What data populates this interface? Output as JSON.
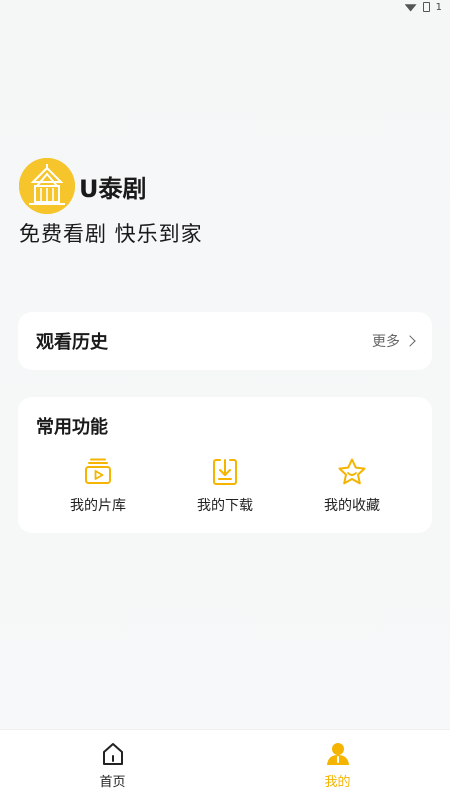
{
  "status_bar": {
    "time_fragment": "1"
  },
  "app": {
    "name": "U泰剧",
    "slogan": "免费看剧 快乐到家"
  },
  "history": {
    "title": "观看历史",
    "more_label": "更多"
  },
  "functions": {
    "title": "常用功能",
    "items": [
      {
        "label": "我的片库",
        "icon": "film-library-icon"
      },
      {
        "label": "我的下载",
        "icon": "download-icon"
      },
      {
        "label": "我的收藏",
        "icon": "star-favorite-icon"
      }
    ]
  },
  "tabbar": {
    "tabs": [
      {
        "label": "首页",
        "icon": "home-icon",
        "active": false
      },
      {
        "label": "我的",
        "icon": "user-icon",
        "active": true
      }
    ]
  },
  "colors": {
    "accent": "#f4b400",
    "logo_bg": "#f6c52c",
    "card_bg": "#ffffff",
    "page_bg": "#f6f8f9"
  }
}
